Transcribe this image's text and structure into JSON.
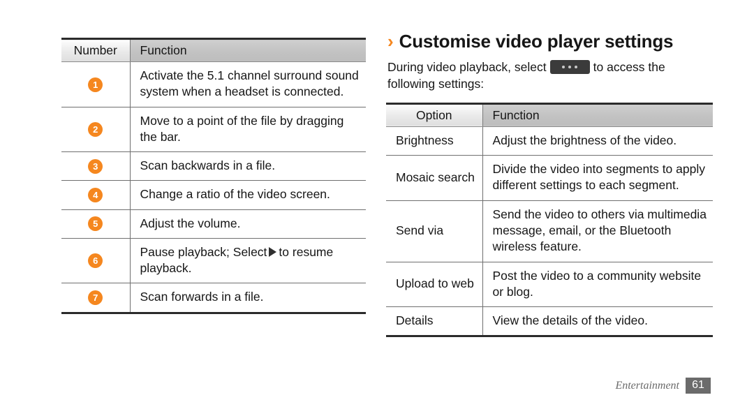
{
  "page": {
    "background_color": "#ffffff",
    "accent_color": "#f5871f",
    "footer": {
      "chapter": "Entertainment",
      "page_number": "61"
    }
  },
  "left_table": {
    "name": "video-player-controls-table",
    "headers": [
      "Number",
      "Function"
    ],
    "rows": [
      {
        "number": "1",
        "function": "Activate the 5.1 channel surround sound system when a headset is connected."
      },
      {
        "number": "2",
        "function": "Move to a point of the file by dragging the bar."
      },
      {
        "number": "3",
        "function": "Scan backwards in a file."
      },
      {
        "number": "4",
        "function": "Change a ratio of the video screen."
      },
      {
        "number": "5",
        "function": "Adjust the volume."
      },
      {
        "number": "6",
        "function_before_icon": "Pause playback; Select",
        "function_icon": "play-icon",
        "function_after_icon": "to resume playback."
      },
      {
        "number": "7",
        "function": "Scan forwards in a file."
      }
    ]
  },
  "right_section": {
    "chevron": "›",
    "title": "Customise video player settings",
    "intro_before_icon": "During video playback, select",
    "intro_icon": "options-dots-button",
    "intro_after_icon": "to access the following settings:",
    "table": {
      "name": "video-player-settings-table",
      "headers": [
        "Option",
        "Function"
      ],
      "rows": [
        {
          "option": "Brightness",
          "function": "Adjust the brightness of the video."
        },
        {
          "option": "Mosaic search",
          "function": "Divide the video into segments to apply different settings to each segment."
        },
        {
          "option": "Send via",
          "function": "Send the video to others via multimedia message, email, or the Bluetooth wireless feature."
        },
        {
          "option": "Upload to web",
          "function": "Post the video to a community website or blog."
        },
        {
          "option": "Details",
          "function": "View the details of the video."
        }
      ]
    }
  }
}
